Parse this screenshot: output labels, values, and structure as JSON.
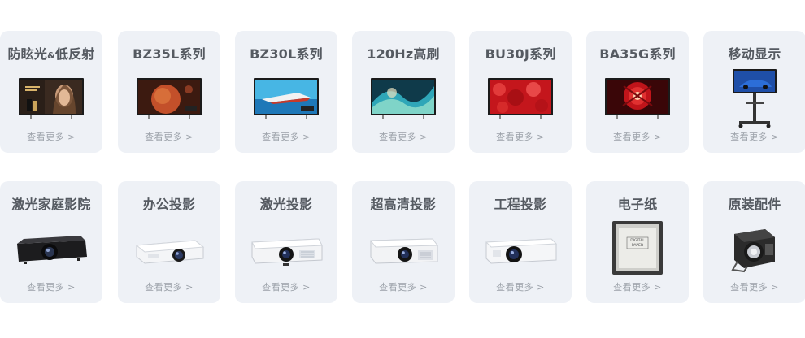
{
  "more_label": "查看更多 >",
  "row1": [
    {
      "title": "防眩光",
      "title_amp": "&",
      "title_tail": "低反射",
      "icon": "tv-woman-icon"
    },
    {
      "title": "BZ35L系列",
      "icon": "tv-planet-icon"
    },
    {
      "title": "BZ30L系列",
      "icon": "tv-boat-icon"
    },
    {
      "title": "120Hz高刷",
      "icon": "tv-abstract-icon"
    },
    {
      "title": "BU30J系列",
      "icon": "tv-red-icon"
    },
    {
      "title": "BA35G系列",
      "icon": "tv-flower-icon"
    },
    {
      "title": "移动显示",
      "icon": "tv-stand-icon"
    }
  ],
  "row2": [
    {
      "title": "激光家庭影院",
      "icon": "home-projector-icon"
    },
    {
      "title": "办公投影",
      "icon": "office-projector-icon"
    },
    {
      "title": "激光投影",
      "icon": "laser-projector-icon"
    },
    {
      "title": "超高清投影",
      "icon": "uhd-projector-icon"
    },
    {
      "title": "工程投影",
      "icon": "engineering-projector-icon"
    },
    {
      "title": "电子纸",
      "icon": "epaper-icon"
    },
    {
      "title": "原装配件",
      "icon": "lamp-accessory-icon"
    }
  ],
  "epaper_label_1": "DIGITAL",
  "epaper_label_2": "PAPER",
  "colors": {
    "card_bg": "#eef1f6",
    "title": "#555a61",
    "more": "#9aa0a8"
  }
}
